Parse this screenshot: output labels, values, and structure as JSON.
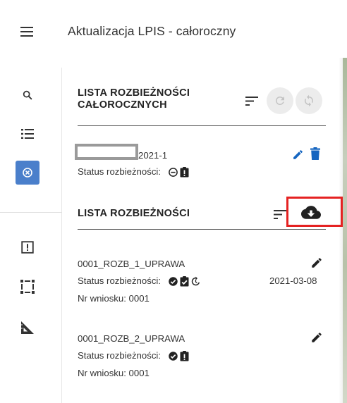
{
  "header": {
    "title": "Aktualizacja LPIS - całoroczny"
  },
  "sidebar": {
    "tools": [
      {
        "icon": "search-icon"
      },
      {
        "icon": "list-icon"
      },
      {
        "icon": "cancel-circle-icon",
        "active": true
      },
      {
        "icon": "alert-box-icon"
      },
      {
        "icon": "select-area-icon"
      },
      {
        "icon": "measure-angle-icon"
      }
    ],
    "active_color": "#4a7fcb"
  },
  "section_yearly": {
    "title_line1": "LISTA ROZBIEŻNOŚCI",
    "title_line2": "CAŁOROCZNYCH",
    "item": {
      "id_suffix": "2021-1",
      "status_label": "Status rozbieżności:"
    }
  },
  "section_list": {
    "title": "LISTA ROZBIEŻNOŚCI",
    "items": [
      {
        "name": "0001_ROZB_1_UPRAWA",
        "status_label": "Status rozbieżności:",
        "date": "2021-03-08",
        "request_label": "Nr wniosku: 0001"
      },
      {
        "name": "0001_ROZB_2_UPRAWA",
        "status_label": "Status rozbieżności:",
        "request_label": "Nr wniosku: 0001"
      }
    ]
  },
  "colors": {
    "accent_blue": "#1565c0",
    "highlight_red": "#e52222",
    "text_dark": "#222222"
  }
}
